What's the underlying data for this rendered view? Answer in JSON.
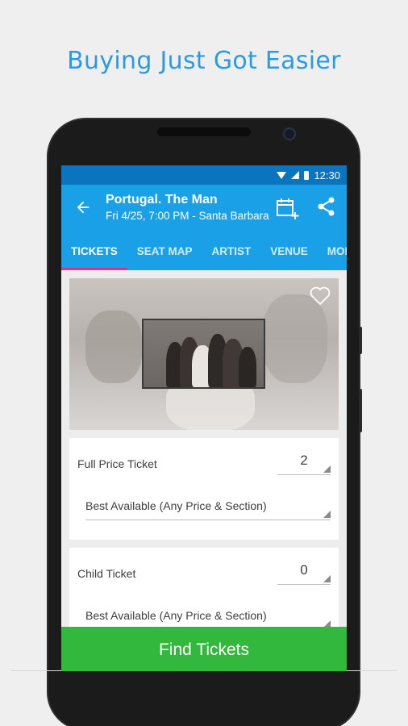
{
  "headline": "Buying Just Got Easier",
  "status_bar": {
    "time": "12:30"
  },
  "app_bar": {
    "title": "Portugal. The Man",
    "subtitle": "Fri 4/25, 7:00 PM - Santa Barbara"
  },
  "tabs": [
    {
      "label": "TICKETS",
      "active": true
    },
    {
      "label": "SEAT MAP",
      "active": false
    },
    {
      "label": "ARTIST",
      "active": false
    },
    {
      "label": "VENUE",
      "active": false
    },
    {
      "label": "MOBI",
      "active": false
    }
  ],
  "tickets": [
    {
      "label": "Full Price Ticket",
      "quantity": "2",
      "section": "Best Available (Any Price & Section)"
    },
    {
      "label": "Child Ticket",
      "quantity": "0",
      "section": "Best Available (Any Price & Section)"
    }
  ],
  "cta": {
    "label": "Find Tickets"
  },
  "colors": {
    "accent": "#1aa0e6",
    "status": "#0a74bf",
    "tab_indicator": "#e0308a",
    "cta": "#32b83c",
    "headline": "#2b9be0"
  }
}
